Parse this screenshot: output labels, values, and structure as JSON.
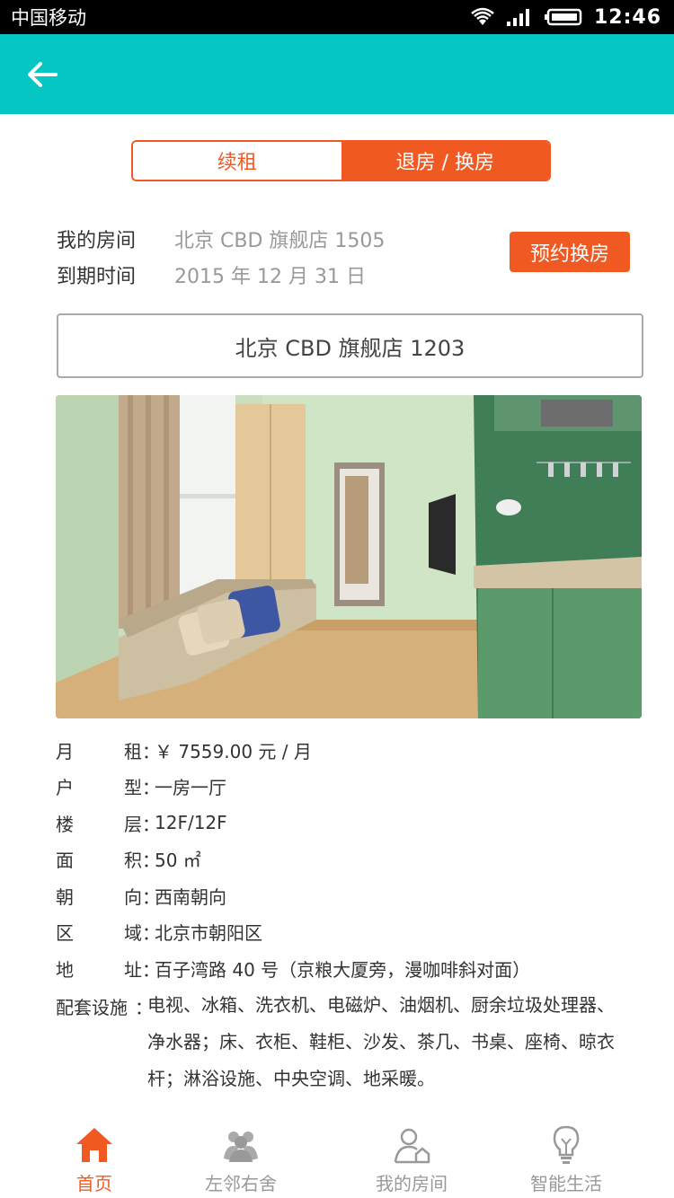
{
  "status_bar": {
    "carrier": "中国移动",
    "time": "12:46"
  },
  "app_bar": {
    "back_icon": "arrow-left-icon"
  },
  "segments": [
    {
      "label": "续租",
      "active": false
    },
    {
      "label": "退房 / 换房",
      "active": true
    }
  ],
  "room_info": {
    "my_room_label": "我的房间",
    "my_room_value": "北京 CBD 旗舰店 1505",
    "expiry_label": "到期时间",
    "expiry_value": "2015 年 12 月 31 日",
    "book_button": "预约换房"
  },
  "selected_room": "北京 CBD 旗舰店 1203",
  "details": [
    {
      "label_chars": [
        "月",
        "租"
      ],
      "value": "￥ 7559.00 元 / 月"
    },
    {
      "label_chars": [
        "户",
        "型"
      ],
      "value": "一房一厅"
    },
    {
      "label_chars": [
        "楼",
        "层"
      ],
      "value": "12F/12F"
    },
    {
      "label_chars": [
        "面",
        "积"
      ],
      "value": "50 ㎡"
    },
    {
      "label_chars": [
        "朝",
        "向"
      ],
      "value": "西南朝向"
    },
    {
      "label_chars": [
        "区",
        "域"
      ],
      "value": "北京市朝阳区"
    },
    {
      "label_chars": [
        "地",
        "址"
      ],
      "value": "百子湾路 40 号（京粮大厦旁，漫咖啡斜对面）"
    }
  ],
  "facilities": {
    "label": "配套设施",
    "lines": [
      "电视、冰箱、洗衣机、电磁炉、油烟机、厨余垃圾处理器、",
      "净水器；床、衣柜、鞋柜、沙发、茶几、书桌、座椅、晾衣",
      "杆；淋浴设施、中央空调、地采暖。"
    ]
  },
  "tabs": [
    {
      "label": "首页",
      "icon": "home-icon",
      "active": true
    },
    {
      "label": "左邻右舍",
      "icon": "neighbors-icon",
      "active": false
    },
    {
      "label": "我的房间",
      "icon": "my-room-icon",
      "active": false
    },
    {
      "label": "智能生活",
      "icon": "smart-life-icon",
      "active": false
    }
  ],
  "colors": {
    "header": "#04c6c3",
    "accent": "#f05a22",
    "tab_inactive": "#999999"
  }
}
